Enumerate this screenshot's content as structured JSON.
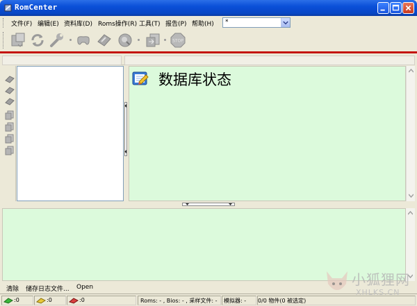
{
  "window": {
    "title": "RomCenter"
  },
  "menu": {
    "items": [
      "文件(F)",
      "编辑(E)",
      "资料库(D)",
      "Roms操作(R)",
      "工具(T)",
      "报告(P)",
      "帮助(H)"
    ],
    "filter_value": "*"
  },
  "toolbar": {
    "icons": [
      "open-database-icon",
      "refresh-icon",
      "wrench-icon",
      "gamepad-icon",
      "fix-roms-icon",
      "search-icon",
      "export-icon",
      "stop-icon"
    ],
    "stop_label": "STOP"
  },
  "main": {
    "heading": "数据库状态"
  },
  "log_actions": {
    "clear": "清除",
    "save_log": "储存日志文件...",
    "open": "Open"
  },
  "statusbar": {
    "green_count": ":0",
    "yellow_count": ":0",
    "red_count": ":0",
    "roms_info": "Roms: - , Bios: - , 采样文件: -",
    "emulator": "模拟器: -",
    "objects": "0/0 物件(0 被选定)"
  },
  "watermark": {
    "brand_cn": "小狐狸网",
    "brand_en": "XHLKS.CN"
  },
  "colors": {
    "title_blue": "#0a4fd8",
    "accent_red": "#c4130c",
    "panel_green": "#dcfadc"
  }
}
